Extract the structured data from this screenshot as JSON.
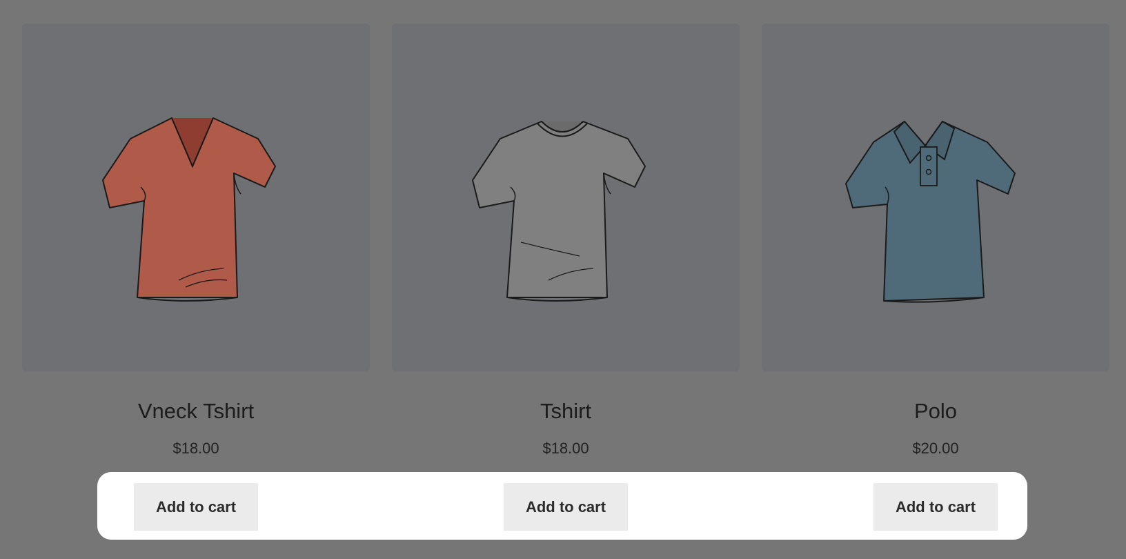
{
  "products": [
    {
      "title": "Vneck Tshirt",
      "price": "$18.00",
      "button_label": "Add to cart",
      "image_icon": "vneck-tshirt-icon",
      "color": "#b05a49"
    },
    {
      "title": "Tshirt",
      "price": "$18.00",
      "button_label": "Add to cart",
      "image_icon": "tshirt-icon",
      "color": "#808080"
    },
    {
      "title": "Polo",
      "price": "$20.00",
      "button_label": "Add to cart",
      "image_icon": "polo-shirt-icon",
      "color": "#4f6a78"
    }
  ],
  "colors": {
    "overlay": "#767676",
    "image_bg": "#6f7073",
    "panel": "#ffffff",
    "button": "#ebebeb"
  }
}
